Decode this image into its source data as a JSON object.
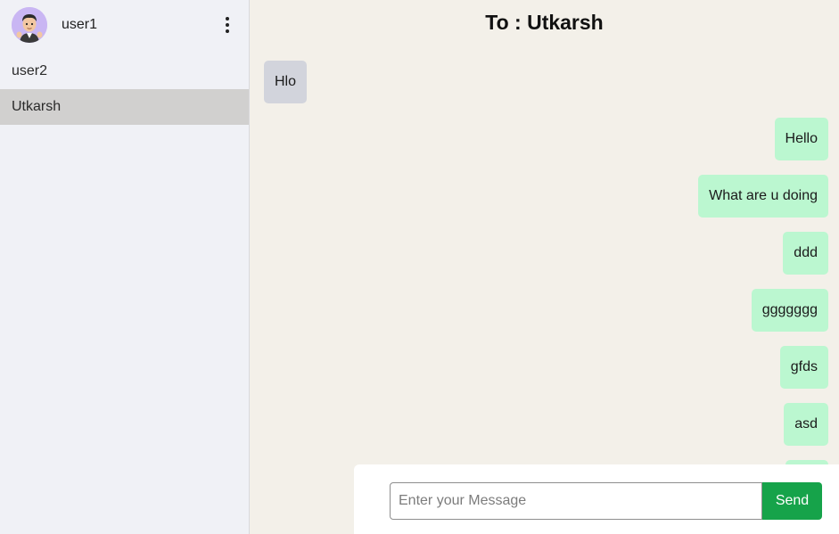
{
  "sidebar": {
    "current_user": {
      "name": "user1",
      "avatar_icon": "memoji-avatar-icon"
    },
    "menu_icon": "kebab-menu-icon",
    "contacts": [
      {
        "name": "user2",
        "active": false
      },
      {
        "name": "Utkarsh",
        "active": true
      }
    ]
  },
  "chat": {
    "title": "To : Utkarsh",
    "messages": [
      {
        "text": "Hlo",
        "direction": "incoming"
      },
      {
        "text": "Hello",
        "direction": "outgoing"
      },
      {
        "text": "What are u doing",
        "direction": "outgoing"
      },
      {
        "text": "ddd",
        "direction": "outgoing"
      },
      {
        "text": "ggggggg",
        "direction": "outgoing"
      },
      {
        "text": "gfds",
        "direction": "outgoing"
      },
      {
        "text": "asd",
        "direction": "outgoing"
      },
      {
        "text": "",
        "direction": "outgoing"
      }
    ]
  },
  "composer": {
    "placeholder": "Enter your Message",
    "value": "",
    "send_label": "Send"
  },
  "colors": {
    "sidebar_bg": "#f0f1f6",
    "active_contact": "#d1d0cf",
    "chat_bg": "#f3f0e9",
    "incoming_bubble": "#d2d4dc",
    "outgoing_bubble": "#bbf7d0",
    "send_button": "#16a34a"
  }
}
